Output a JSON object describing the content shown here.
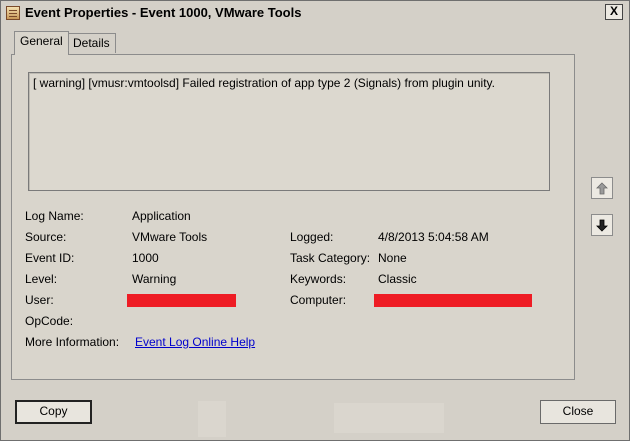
{
  "window": {
    "title": "Event Properties - Event 1000, VMware Tools",
    "close_glyph": "X"
  },
  "tabs": [
    {
      "label": "General",
      "active": true
    },
    {
      "label": "Details",
      "active": false
    }
  ],
  "message": "[ warning] [vmusr:vmtoolsd] Failed registration of app type 2 (Signals) from plugin unity.",
  "fields": {
    "log_name": {
      "label": "Log Name:",
      "value": "Application"
    },
    "source": {
      "label": "Source:",
      "value": "VMware Tools"
    },
    "event_id": {
      "label": "Event ID:",
      "value": "1000"
    },
    "level": {
      "label": "Level:",
      "value": "Warning"
    },
    "user": {
      "label": "User:",
      "value": ""
    },
    "opcode": {
      "label": "OpCode:",
      "value": ""
    },
    "more_info": {
      "label": "More Information:",
      "value": "Event Log Online Help"
    },
    "logged": {
      "label": "Logged:",
      "value": "4/8/2013 5:04:58 AM"
    },
    "task_category": {
      "label": "Task Category:",
      "value": "None"
    },
    "keywords": {
      "label": "Keywords:",
      "value": "Classic"
    },
    "computer": {
      "label": "Computer:",
      "value": ""
    }
  },
  "redaction_color": "#ee1c24",
  "link_color": "#0000cc",
  "nav": {
    "up_icon": "arrow-up-icon",
    "down_icon": "arrow-down-icon"
  },
  "buttons": {
    "copy": "Copy",
    "close": "Close"
  }
}
